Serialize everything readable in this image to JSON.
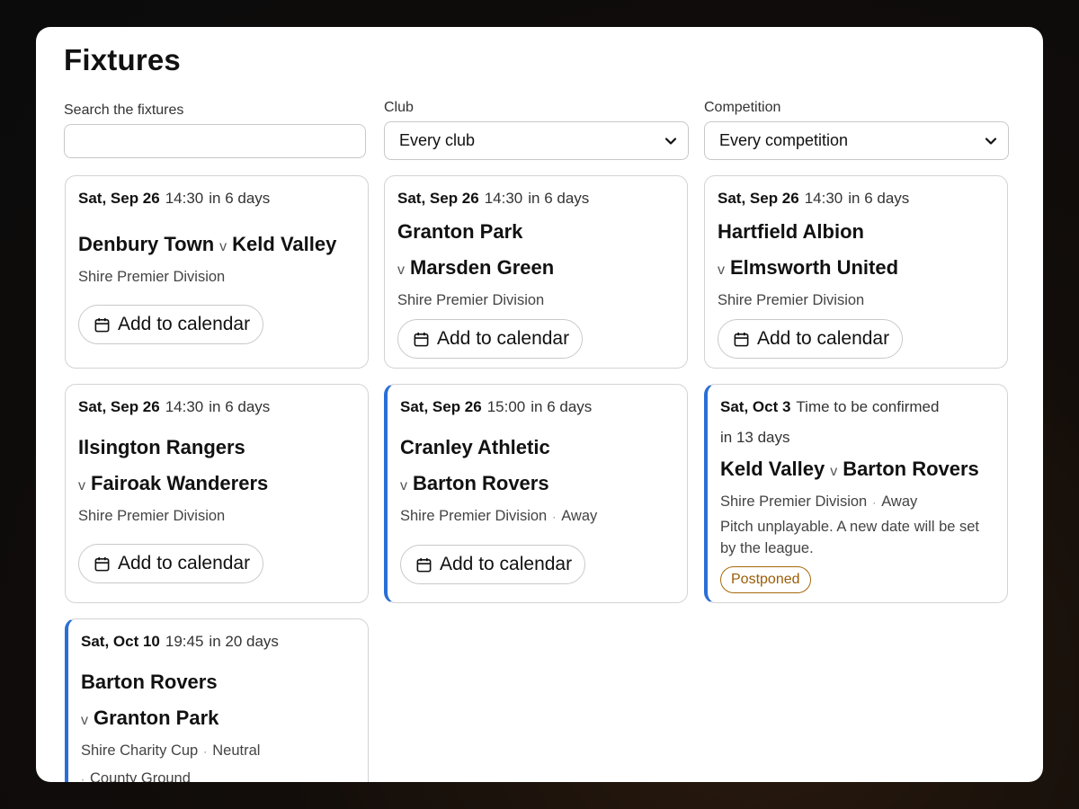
{
  "page": {
    "title": "Fixtures"
  },
  "filters": {
    "search_label": "Search the fixtures",
    "search_value": "",
    "club_label": "Club",
    "club_selected": "Every club",
    "competition_label": "Competition",
    "competition_selected": "Every competition"
  },
  "calendar_label": "Add to calendar",
  "fixtures": [
    {
      "date": "Sat, Sep 26",
      "time": "14:30",
      "relative": "in 6 days",
      "home": "Denbury Town",
      "v": "v",
      "away": "Keld Valley",
      "competition": "Shire Premier Division"
    },
    {
      "date": "Sat, Sep 26",
      "time": "14:30",
      "relative": "in 6 days",
      "home": "Granton Park",
      "v": "v",
      "away": "Marsden Green",
      "competition": "Shire Premier Division"
    },
    {
      "date": "Sat, Sep 26",
      "time": "14:30",
      "relative": "in 6 days",
      "home": "Hartfield Albion",
      "v": "v",
      "away": "Elmsworth United",
      "competition": "Shire Premier Division"
    },
    {
      "date": "Sat, Sep 26",
      "time": "14:30",
      "relative": "in 6 days",
      "home": "Ilsington Rangers",
      "v": "v",
      "away": "Fairoak Wanderers",
      "competition": "Shire Premier Division"
    },
    {
      "date": "Sat, Sep 26",
      "time": "15:00",
      "relative": "in 6 days",
      "home": "Cranley Athletic",
      "v": "v",
      "away": "Barton Rovers",
      "competition": "Shire Premier Division",
      "venue_type": "Away"
    },
    {
      "date": "Sat, Oct 3",
      "time": "Time to be confirmed",
      "relative": "in 13 days",
      "home": "Keld Valley",
      "v": "v",
      "away": "Barton Rovers",
      "competition": "Shire Premier Division",
      "venue_type": "Away",
      "note": "Pitch unplayable. A new date will be set by the league.",
      "status": "Postponed"
    },
    {
      "date": "Sat, Oct 10",
      "time": "19:45",
      "relative": "in 20 days",
      "home": "Barton Rovers",
      "v": "v",
      "away": "Granton Park",
      "competition": "Shire Charity Cup",
      "venue_type": "Neutral",
      "venue": "County Ground"
    }
  ],
  "colors": {
    "accent": "#2a6fd6",
    "postponed": "#9a5d07"
  }
}
